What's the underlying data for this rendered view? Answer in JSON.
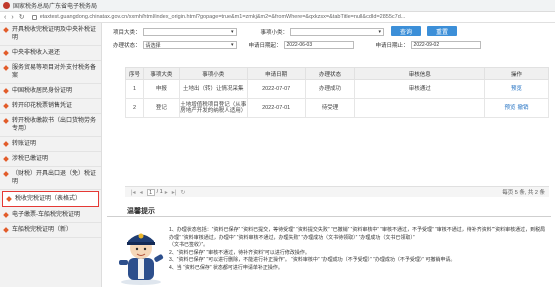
{
  "browser": {
    "tab_title": "国家税务总局广东省电子税务局",
    "url": "etaxtest.guangdong.chinatax.gov.cn/xxmh/html/index_origin.html?gopage=true&m1=zmkj&m2=&fromWhere=&qxkzsx=&tabTitle=null&cdId=2855c7d..."
  },
  "sidebar": {
    "items": [
      "开具税收完税证明及中央补税证明",
      "中央非税收入退还",
      "服务贸易等项目对外支付税务备案",
      "中国税收居民身份证明",
      "转开印花税票销售凭证",
      "转开税收缴款书（出口货物劳务专用）",
      "转账证明",
      "涉税已缴证明",
      "（财税）开具出口退（免）税证明",
      "税收完税证明（表格式）",
      "电子缴票-车船税完税证明",
      "车船税完税证明（新）"
    ],
    "selected_index": 9
  },
  "form": {
    "row1": {
      "label1": "项目大类：",
      "label2": "事项小类："
    },
    "row2": {
      "status_label": "办理状态：",
      "status_value": "请选择",
      "start_label": "申请日期起：",
      "start_value": "2022-06-03",
      "end_label": "申请日期止：",
      "end_value": "2022-09-02"
    },
    "query_btn": "查询",
    "reset_btn": "重置"
  },
  "table": {
    "headers": [
      "序号",
      "事项大类",
      "事项小类",
      "申请日期",
      "办理状态",
      "审核信息",
      "操作"
    ],
    "rows": [
      {
        "no": "1",
        "category": "申报",
        "item": "土地出（转）让情况采集",
        "date": "2022-07-07",
        "status": "办理成功",
        "audit": "审核通过",
        "ops": [
          "预览"
        ]
      },
      {
        "no": "2",
        "category": "登记",
        "item": "土地增值税项目登记（从事房地产开发的纳税人适用）",
        "date": "2022-07-01",
        "status": "待受理",
        "audit": "",
        "ops": [
          "预览",
          "撤销"
        ]
      }
    ]
  },
  "pager": {
    "page": "1",
    "total_pages": "/ 1",
    "info": "每页 5 条, 共 2 条"
  },
  "hints": {
    "title": "温馨提示",
    "lines": [
      "1、办理状态包括：“资料已保存” “资料已提交，等待受理” “资料提交失败” “已撤销” “资料审核中” “审核不通过，不予受理” “审核不通过，待补齐资料”“资料审核通过，到税局办理” “资料审核通过，办理中” “资料审核不通过，办理失败” “办理成功（文书待领取）” “办理成功（文书已领取）”",
      "（文书已签收）”。",
      "2、“资料已保存” “审核不通过，待补齐资料”可以进行修改操作。",
      "3、“资料已保存” “可以进行删除，不能进行补正操作”。 “资料审核中” “办理成功（不予受理）” “办理成功（不予受理）” 可撤销申请。",
      "4、当 “资料已保存” 状态都可进行申请单补正操作。"
    ]
  },
  "colors": {
    "accent_blue": "#3c8fd8",
    "selected_border": "#e53935",
    "link_blue": "#1f6fc2"
  }
}
